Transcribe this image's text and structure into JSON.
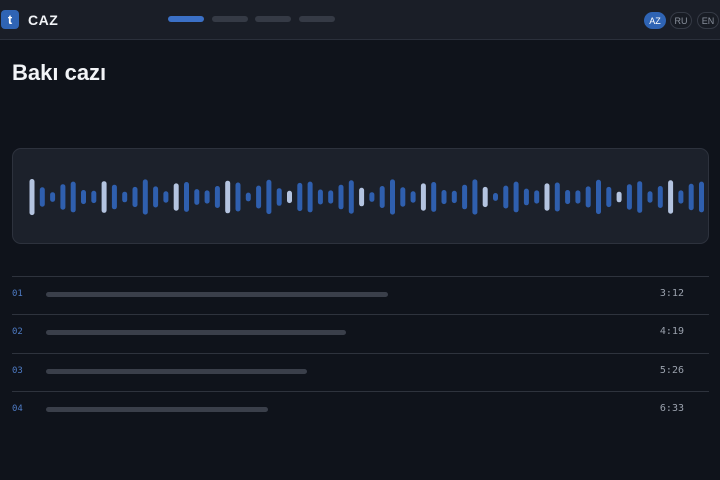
{
  "app": {
    "logo_letter": "t",
    "name": "CAZ"
  },
  "header": {
    "page_tabs": [
      {
        "active": true
      },
      {
        "active": false
      },
      {
        "active": false
      },
      {
        "active": false
      }
    ],
    "languages": [
      {
        "code": "AZ",
        "active": true
      },
      {
        "code": "RU",
        "active": false
      },
      {
        "code": "EN",
        "active": false
      }
    ]
  },
  "page": {
    "title": "Bakı cazı"
  },
  "colors": {
    "accent": "#2f64b4",
    "wave_bar": "#2f5fae",
    "wave_bar_highlight": "#b4c4e0",
    "background": "#0f131b",
    "card": "#1c212b"
  },
  "waveform": {
    "levels": [
      0.82,
      0.44,
      0.22,
      0.58,
      0.7,
      0.32,
      0.28,
      0.72,
      0.56,
      0.24,
      0.46,
      0.8,
      0.48,
      0.26,
      0.62,
      0.68,
      0.36,
      0.3,
      0.5,
      0.74,
      0.66,
      0.2,
      0.52,
      0.78,
      0.4,
      0.28,
      0.64,
      0.7,
      0.34,
      0.3,
      0.56,
      0.76,
      0.42,
      0.22,
      0.5,
      0.8,
      0.44,
      0.26,
      0.62,
      0.68,
      0.32,
      0.28,
      0.56,
      0.8,
      0.46,
      0.18,
      0.52,
      0.7,
      0.38,
      0.3,
      0.62,
      0.66,
      0.32,
      0.3,
      0.48,
      0.78,
      0.46,
      0.24,
      0.58,
      0.72,
      0.26,
      0.5,
      0.76,
      0.3,
      0.6,
      0.7
    ],
    "highlight_indices": [
      0,
      7,
      14,
      19,
      25,
      32,
      38,
      44,
      50,
      57,
      62
    ]
  },
  "tracks": [
    {
      "number": "01",
      "duration": "3:12",
      "title_length": 0.49
    },
    {
      "number": "02",
      "duration": "4:19",
      "title_length": 0.43
    },
    {
      "number": "03",
      "duration": "5:26",
      "title_length": 0.375
    },
    {
      "number": "04",
      "duration": "6:33",
      "title_length": 0.318
    }
  ]
}
